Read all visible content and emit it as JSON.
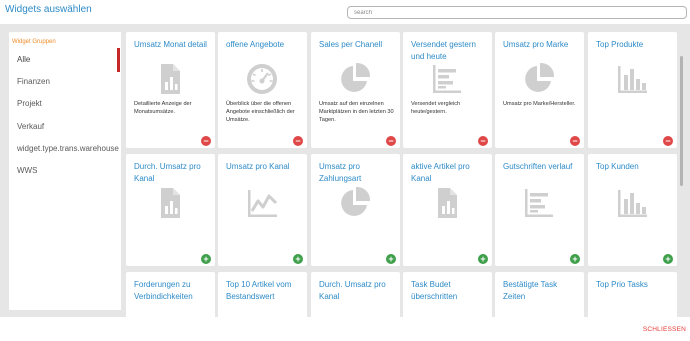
{
  "header": {
    "title": "Widgets auswählen",
    "search_placeholder": "search"
  },
  "sidebar": {
    "heading": "Widget Gruppen",
    "items": [
      "Alle",
      "Finanzen",
      "Projekt",
      "Verkauf",
      "widget.type.trans.warehouse",
      "WWS"
    ],
    "active_index": 0
  },
  "widgets": [
    {
      "title": "Umsatz Monat detail",
      "description": "Detaillierte Anzeige der Monatsumsätze.",
      "icon": "document-chart-icon",
      "action": "remove"
    },
    {
      "title": "offene Angebote",
      "description": "Überblick über die offenen Angebote einschließlich der Umsätze.",
      "icon": "gauge-icon",
      "action": "remove"
    },
    {
      "title": "Sales per Chanell",
      "description": "Umsatz auf den einzelnen Marktplätzen in den letzten 30 Tagen.",
      "icon": "pie-chart-icon",
      "action": "remove"
    },
    {
      "title": "Versendet gestern und heute",
      "description": "Versendet vergleich heute/gestern.",
      "icon": "horizontal-bar-chart-icon",
      "action": "remove"
    },
    {
      "title": "Umsatz pro Marke",
      "description": "Umsatz pro Marke/Hersteller.",
      "icon": "pie-chart-icon",
      "action": "remove"
    },
    {
      "title": "Top Produkte",
      "description": "",
      "icon": "bar-chart-icon",
      "action": "remove"
    },
    {
      "title": "Durch. Umsatz pro Kanal",
      "description": "",
      "icon": "document-chart-icon",
      "action": "add"
    },
    {
      "title": "Umsatz pro Kanal",
      "description": "",
      "icon": "line-chart-icon",
      "action": "add"
    },
    {
      "title": "Umsatz pro Zahlungsart",
      "description": "",
      "icon": "pie-chart-icon",
      "action": "add"
    },
    {
      "title": "aktive Artikel pro Kanal",
      "description": "",
      "icon": "document-chart-icon",
      "action": "add"
    },
    {
      "title": "Gutschriften verlauf",
      "description": "",
      "icon": "horizontal-bar-chart-icon",
      "action": "add"
    },
    {
      "title": "Top Kunden",
      "description": "",
      "icon": "bar-chart-icon",
      "action": "add"
    },
    {
      "title": "Forderungen zu Verbindichkeiten",
      "description": "",
      "icon": "",
      "action": ""
    },
    {
      "title": "Top 10 Artikel vom Bestandswert",
      "description": "",
      "icon": "",
      "action": ""
    },
    {
      "title": "Durch. Umsatz pro Kanal",
      "description": "",
      "icon": "",
      "action": ""
    },
    {
      "title": "Task Budet überschritten",
      "description": "",
      "icon": "",
      "action": ""
    },
    {
      "title": "Bestätigte Task Zeiten",
      "description": "",
      "icon": "",
      "action": ""
    },
    {
      "title": "Top Prio Tasks",
      "description": "",
      "icon": "",
      "action": ""
    }
  ],
  "footer": {
    "close_label": "SCHLIESSEN"
  },
  "colors": {
    "accent": "#2e8bc8",
    "group_heading": "#f08c2a",
    "remove": "#e04747",
    "add": "#3fa04b",
    "icon_gray": "#cfcfcf",
    "background": "#e6e6e6"
  }
}
